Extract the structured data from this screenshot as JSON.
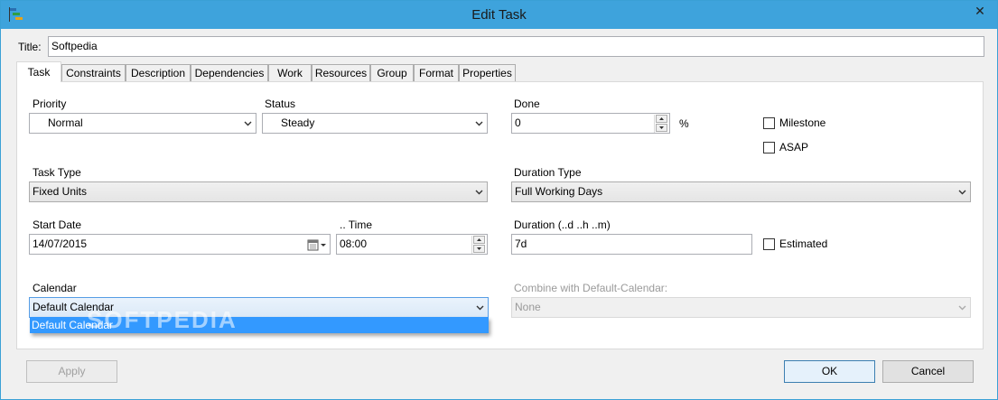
{
  "window": {
    "title": "Edit Task",
    "close_glyph": "✕"
  },
  "form": {
    "title_label": "Title:",
    "title_value": "Softpedia"
  },
  "tabs": [
    {
      "label": "Task"
    },
    {
      "label": "Constraints"
    },
    {
      "label": "Description"
    },
    {
      "label": "Dependencies"
    },
    {
      "label": "Work"
    },
    {
      "label": "Resources"
    },
    {
      "label": "Group"
    },
    {
      "label": "Format"
    },
    {
      "label": "Properties"
    }
  ],
  "task": {
    "priority_label": "Priority",
    "priority_value": "Normal",
    "status_label": "Status",
    "status_value": "Steady",
    "done_label": "Done",
    "done_value": "0",
    "done_unit": "%",
    "milestone_label": "Milestone",
    "asap_label": "ASAP",
    "task_type_label": "Task Type",
    "task_type_value": "Fixed Units",
    "duration_type_label": "Duration Type",
    "duration_type_value": "Full Working Days",
    "start_date_label": "Start Date",
    "start_date_value": "14/07/2015",
    "time_label": ".. Time",
    "time_value": "08:00",
    "duration_label": "Duration  (..d ..h ..m)",
    "duration_value": "7d",
    "estimated_label": "Estimated",
    "calendar_label": "Calendar",
    "calendar_value": "Default Calendar",
    "calendar_options": [
      "Default Calendar"
    ],
    "combine_label": "Combine with Default-Calendar:",
    "combine_value": "None"
  },
  "footer": {
    "apply_label": "Apply",
    "ok_label": "OK",
    "cancel_label": "Cancel"
  },
  "watermark": "SOFTPEDIA",
  "icons": {
    "app": "gantt-icon",
    "dropdown": "chevron-down-icon",
    "calendar": "calendar-icon",
    "spin_up": "arrow-up-icon",
    "spin_down": "arrow-down-icon"
  },
  "colors": {
    "titlebar": "#3ea3dc",
    "selection": "#3399ff",
    "focus_border": "#569de5"
  }
}
